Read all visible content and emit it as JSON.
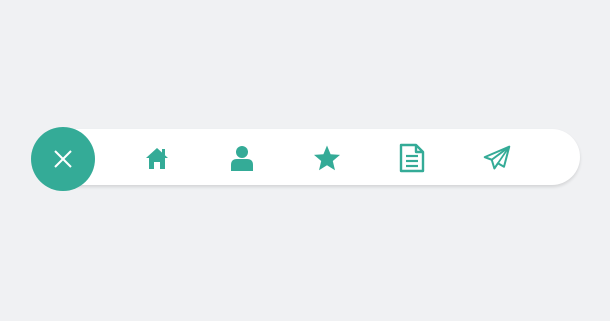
{
  "colors": {
    "accent": "#34ab97",
    "bar_background": "#ffffff",
    "page_background": "#f0f1f3",
    "fab_icon": "#ffffff"
  },
  "fab": {
    "icon": "close-icon"
  },
  "nav": {
    "items": [
      {
        "icon": "home-icon"
      },
      {
        "icon": "user-icon"
      },
      {
        "icon": "star-icon"
      },
      {
        "icon": "document-icon"
      },
      {
        "icon": "paper-plane-icon"
      }
    ]
  }
}
